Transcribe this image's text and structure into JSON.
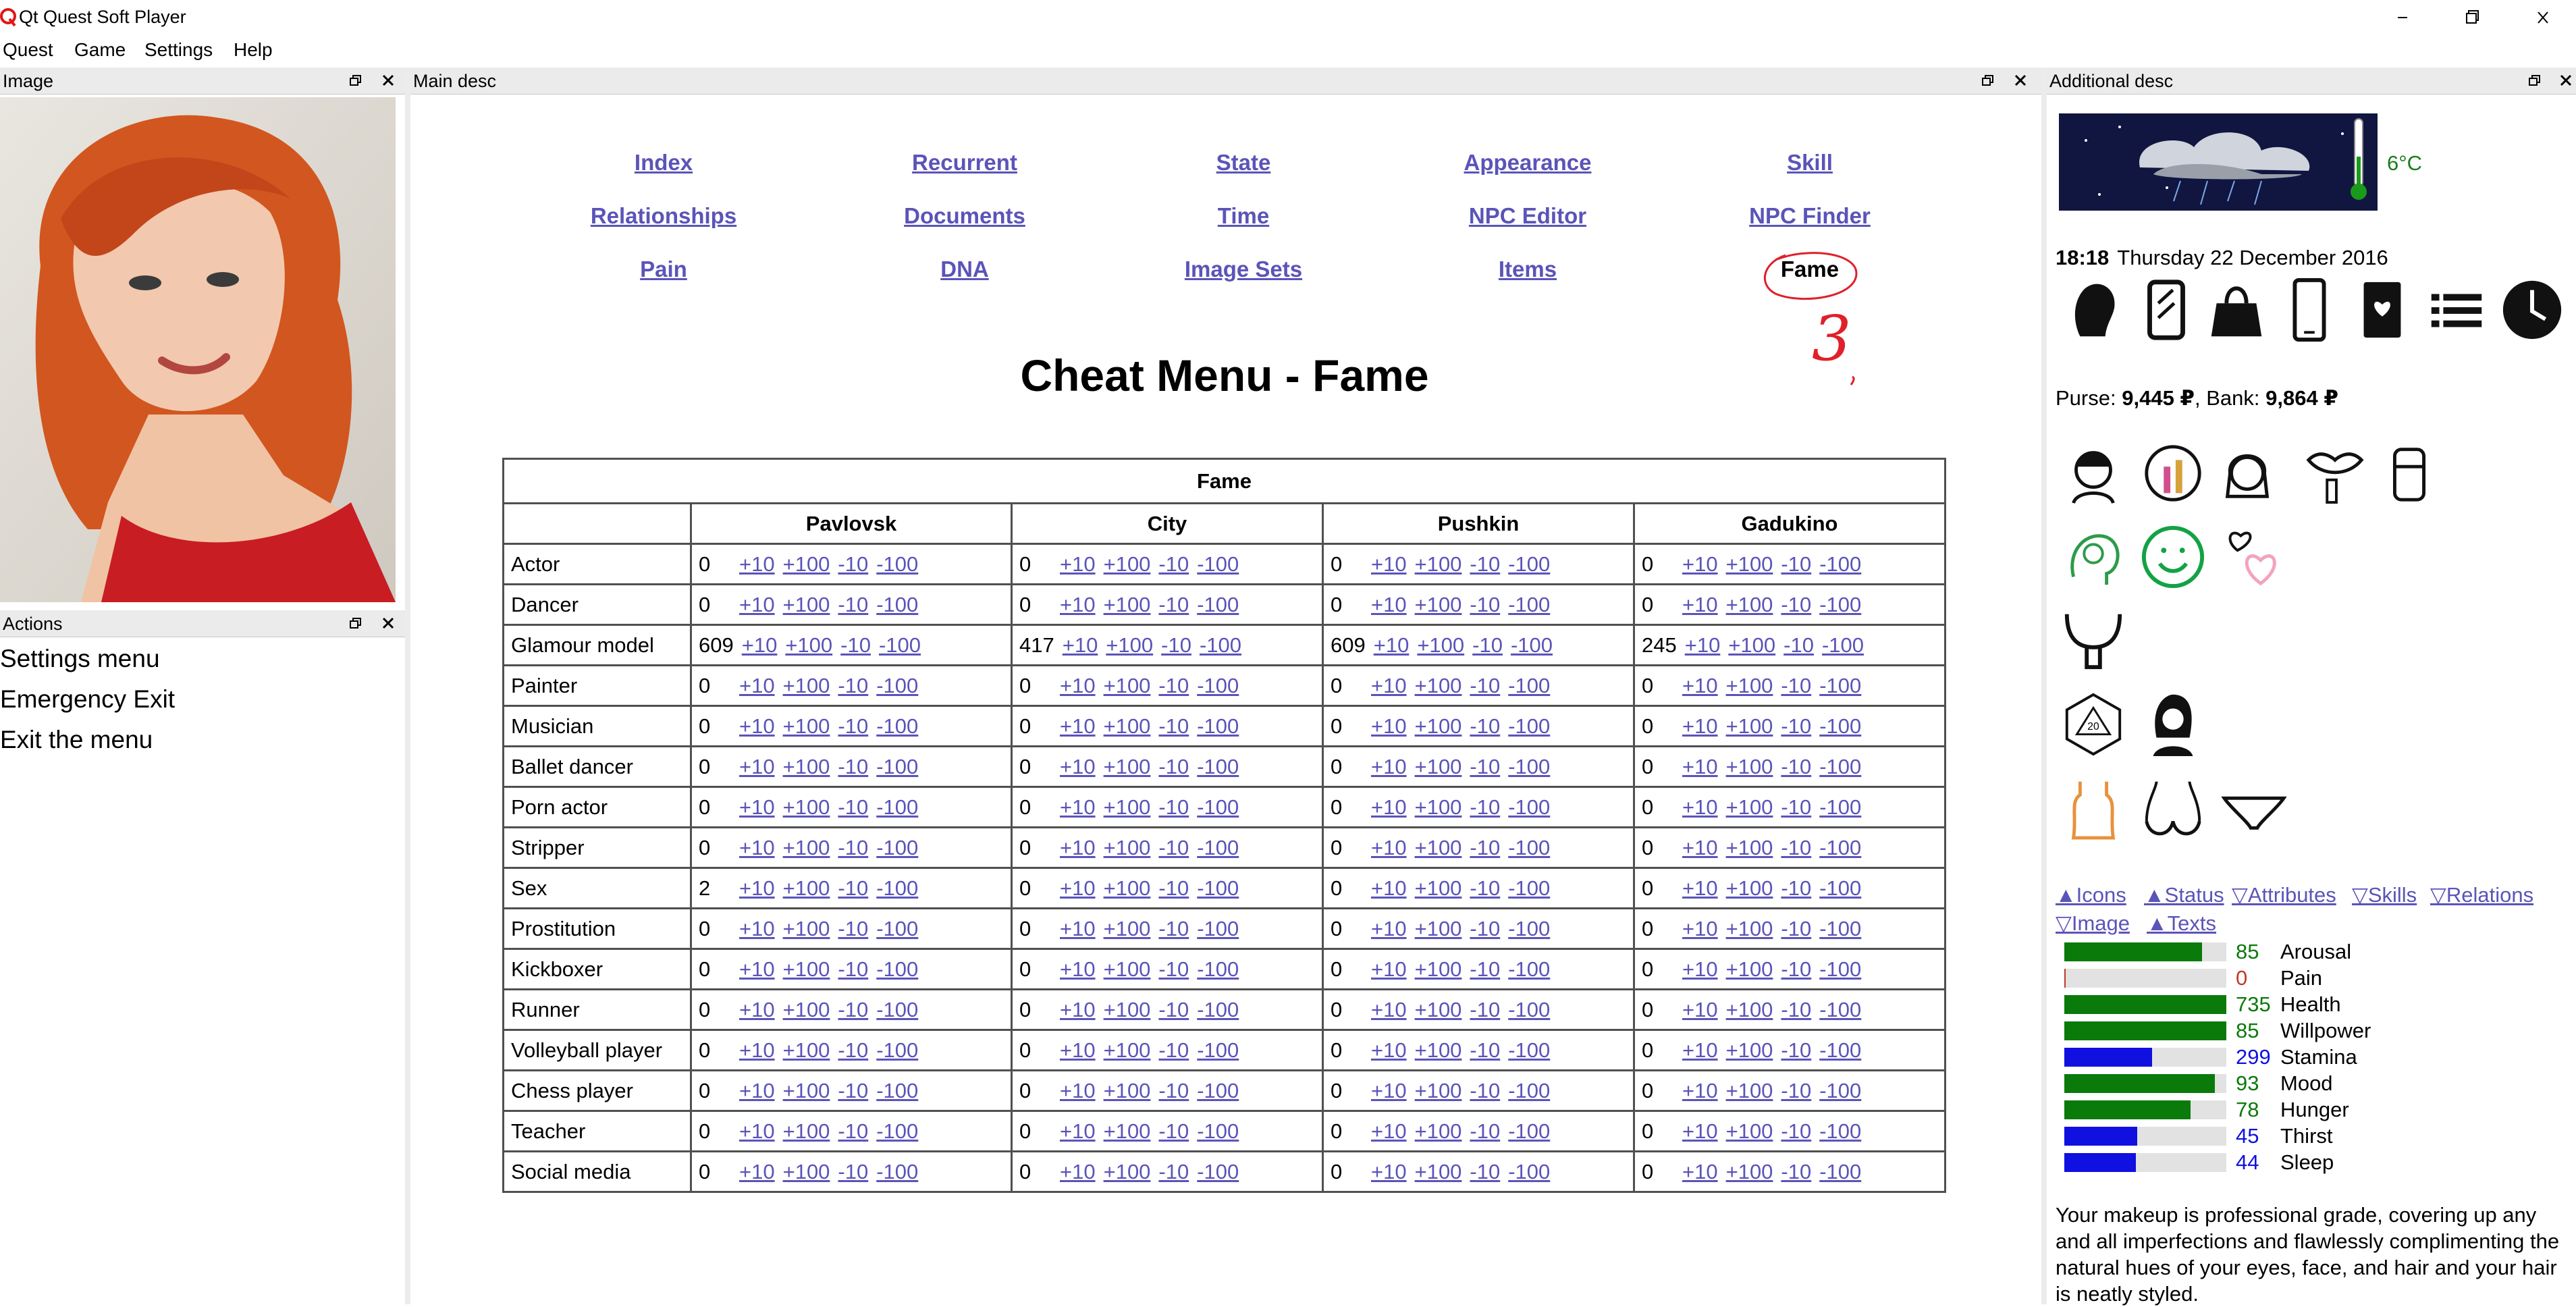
{
  "window": {
    "title": "Qt Quest Soft Player"
  },
  "menu": [
    "Quest",
    "Game",
    "Settings",
    "Help"
  ],
  "docks": {
    "image_title": "Image",
    "actions_title": "Actions",
    "main_title": "Main desc",
    "additional_title": "Additional desc"
  },
  "actions": [
    "Settings menu",
    "Emergency Exit",
    "Exit the menu"
  ],
  "nav": [
    [
      "Index",
      "Recurrent",
      "State",
      "Appearance",
      "Skill"
    ],
    [
      "Relationships",
      "Documents",
      "Time",
      "NPC Editor",
      "NPC Finder"
    ],
    [
      "Pain",
      "DNA",
      "Image Sets",
      "Items",
      "Fame"
    ]
  ],
  "annotation_mark": "3",
  "page_title": "Cheat Menu - Fame",
  "fame_table": {
    "caption": "Fame",
    "locations": [
      "Pavlovsk",
      "City",
      "Pushkin",
      "Gadukino"
    ],
    "adjust_labels": [
      "+10",
      "+100",
      "-10",
      "-100"
    ],
    "rows": [
      {
        "name": "Actor",
        "values": [
          0,
          0,
          0,
          0
        ]
      },
      {
        "name": "Dancer",
        "values": [
          0,
          0,
          0,
          0
        ]
      },
      {
        "name": "Glamour model",
        "values": [
          609,
          417,
          609,
          245
        ]
      },
      {
        "name": "Painter",
        "values": [
          0,
          0,
          0,
          0
        ]
      },
      {
        "name": "Musician",
        "values": [
          0,
          0,
          0,
          0
        ]
      },
      {
        "name": "Ballet dancer",
        "values": [
          0,
          0,
          0,
          0
        ]
      },
      {
        "name": "Porn actor",
        "values": [
          0,
          0,
          0,
          0
        ]
      },
      {
        "name": "Stripper",
        "values": [
          0,
          0,
          0,
          0
        ]
      },
      {
        "name": "Sex",
        "values": [
          2,
          0,
          0,
          0
        ]
      },
      {
        "name": "Prostitution",
        "values": [
          0,
          0,
          0,
          0
        ]
      },
      {
        "name": "Kickboxer",
        "values": [
          0,
          0,
          0,
          0
        ]
      },
      {
        "name": "Runner",
        "values": [
          0,
          0,
          0,
          0
        ]
      },
      {
        "name": "Volleyball player",
        "values": [
          0,
          0,
          0,
          0
        ]
      },
      {
        "name": "Chess player",
        "values": [
          0,
          0,
          0,
          0
        ]
      },
      {
        "name": "Teacher",
        "values": [
          0,
          0,
          0,
          0
        ]
      },
      {
        "name": "Social media",
        "values": [
          0,
          0,
          0,
          0
        ]
      }
    ]
  },
  "sidebar": {
    "temperature": "6°C",
    "time": "18:18",
    "date": "Thursday 22 December 2016",
    "purse_label": "Purse:",
    "purse_value": "9,445 ₽",
    "bank_label": "Bank:",
    "bank_value": "9,864 ₽",
    "toggles": [
      "▲Icons",
      "▲Status",
      "▽Attributes",
      "▽Skills",
      "▽Relations",
      "▽Image",
      "▲Texts"
    ],
    "stats": [
      {
        "value": "85",
        "label": "Arousal",
        "fill_pct": 85,
        "color": "#0a7a0a"
      },
      {
        "value": "0",
        "label": "Pain",
        "fill_pct": 1,
        "color": "#c0392b"
      },
      {
        "value": "735",
        "label": "Health",
        "fill_pct": 100,
        "color": "#0a7a0a"
      },
      {
        "value": "85",
        "label": "Willpower",
        "fill_pct": 100,
        "color": "#0a7a0a"
      },
      {
        "value": "299",
        "label": "Stamina",
        "fill_pct": 54,
        "color": "#1010e0"
      },
      {
        "value": "93",
        "label": "Mood",
        "fill_pct": 93,
        "color": "#0a7a0a"
      },
      {
        "value": "78",
        "label": "Hunger",
        "fill_pct": 78,
        "color": "#0a7a0a"
      },
      {
        "value": "45",
        "label": "Thirst",
        "fill_pct": 45,
        "color": "#1010e0"
      },
      {
        "value": "44",
        "label": "Sleep",
        "fill_pct": 44,
        "color": "#1010e0"
      }
    ],
    "description": "Your makeup is professional grade, covering up any and all imperfections and flawlessly complimenting the natural hues of your eyes, face, and hair and your hair is neatly styled."
  },
  "colors": {
    "link": "#5b54b8",
    "green_text": "#1b7d1b",
    "annotation_red": "#e0202a"
  },
  "icons": {
    "row1": [
      "head-silhouette-icon",
      "mirror-icon",
      "handbag-icon",
      "phone-icon",
      "diary-icon",
      "list-icon",
      "clock-icon"
    ],
    "row2": [
      "face-care-icon",
      "makeup-icon",
      "hairstyle-icon",
      "lipstick-icon",
      "deodorant-icon"
    ],
    "row3": [
      "brain-icon",
      "smiley-icon",
      "hearts-icon"
    ],
    "row4": [
      "uterus-icon"
    ],
    "row5": [
      "d20-dice-icon",
      "woman-portrait-icon"
    ],
    "row6": [
      "top-icon",
      "bra-icon",
      "panties-icon"
    ]
  }
}
